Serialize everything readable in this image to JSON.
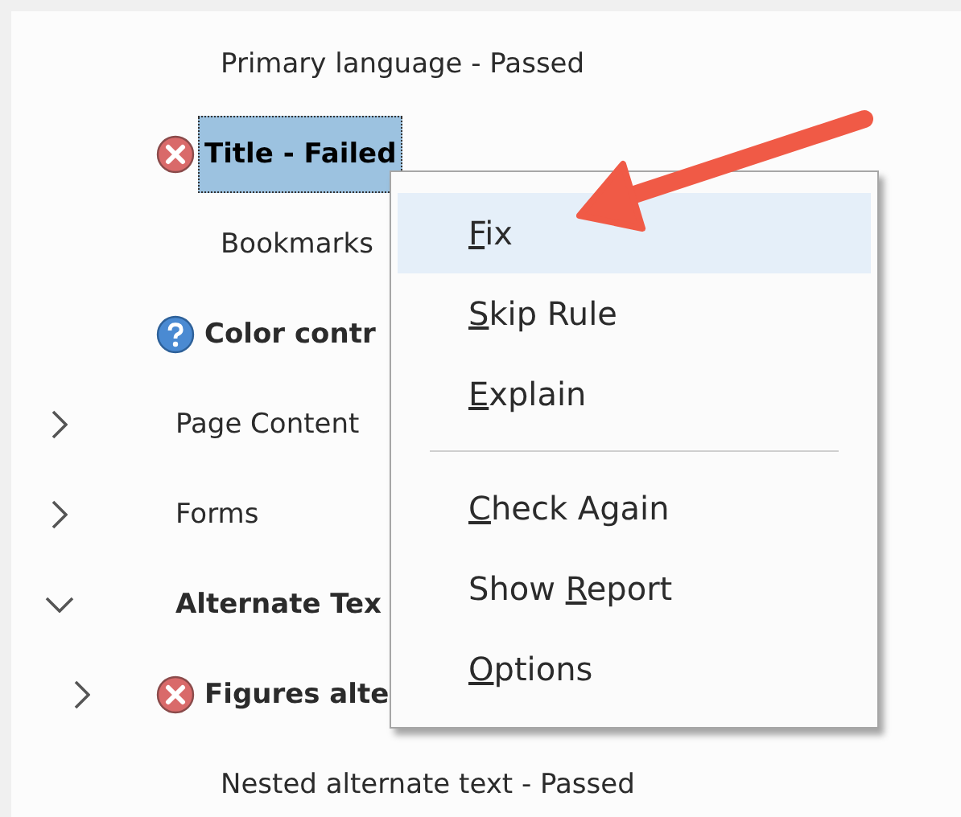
{
  "tree": [
    {
      "kind": "plain",
      "label": "Primary language - Passed",
      "bold": false,
      "selected": false
    },
    {
      "kind": "error",
      "label": "Title - Failed",
      "bold": true,
      "selected": true
    },
    {
      "kind": "plain",
      "label": "Bookmarks",
      "bold": false,
      "selected": false
    },
    {
      "kind": "help",
      "label": "Color contr",
      "bold": true,
      "selected": false
    }
  ],
  "categories": [
    {
      "label": "Page Content",
      "bold": false,
      "selected": false,
      "expanded": false
    },
    {
      "label": "Forms",
      "bold": false,
      "selected": false,
      "expanded": false
    },
    {
      "label": "Alternate Tex",
      "bold": true,
      "selected": false,
      "expanded": true,
      "children": [
        {
          "kind": "error",
          "label": "Figures alte",
          "bold": true,
          "selected": false,
          "expanded": false
        },
        {
          "kind": "plain",
          "label": "Nested alternate text - Passed",
          "bold": false,
          "selected": false
        }
      ]
    }
  ],
  "context_menu": {
    "items": [
      {
        "kind": "item",
        "key": "F",
        "after": "ix",
        "selected": true
      },
      {
        "kind": "item",
        "key": "S",
        "after": "kip Rule",
        "selected": false
      },
      {
        "kind": "item",
        "key": "E",
        "after": "xplain",
        "selected": false
      },
      {
        "kind": "separator"
      },
      {
        "kind": "item",
        "key": "C",
        "after": "heck Again",
        "selected": false
      },
      {
        "kind": "item",
        "before": "Show ",
        "key": "R",
        "after": "eport",
        "selected": false
      },
      {
        "kind": "item",
        "key": "O",
        "after": "ptions",
        "selected": false
      }
    ]
  }
}
